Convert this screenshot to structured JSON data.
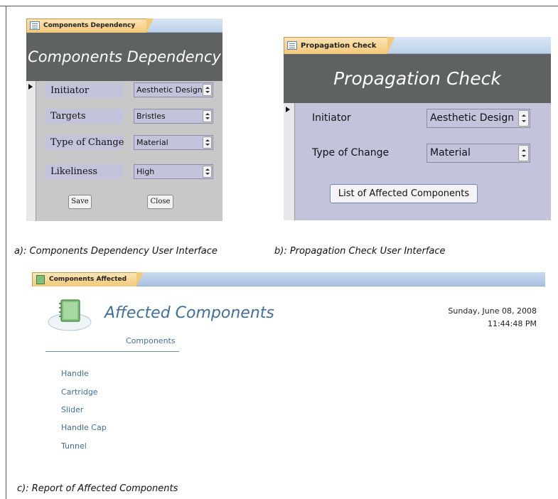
{
  "window_a": {
    "tab_label": "Components Dependency",
    "title": "Components Dependency",
    "fields": [
      {
        "label": "Initiator",
        "value": "Aesthetic Design"
      },
      {
        "label": "Targets",
        "value": "Bristles"
      },
      {
        "label": "Type of Change",
        "value": "Material"
      },
      {
        "label": "Likeliness",
        "value": "High"
      }
    ],
    "save_label": "Save",
    "close_label": "Close"
  },
  "window_b": {
    "tab_label": "Propagation Check",
    "title": "Propagation Check",
    "fields": [
      {
        "label": "Initiator",
        "value": "Aesthetic Design"
      },
      {
        "label": "Type of Change",
        "value": "Material"
      }
    ],
    "button_label": "List of Affected Components"
  },
  "captions": {
    "a": "a): Components Dependency User Interface",
    "b": "b): Propagation Check User Interface",
    "c": "c): Report of Affected Components"
  },
  "window_c": {
    "tab_label": "Components Affected",
    "title": "Affected Components",
    "column_header": "Components",
    "date": "Sunday, June 08, 2008",
    "time": "11:44:48 PM",
    "items": [
      "Handle",
      "Cartridge",
      "Slider",
      "Handle Cap",
      "Tunnel"
    ]
  },
  "colors": {
    "header_gray": "#5f6262",
    "field_lavender": "#c4c3dc",
    "tab_orange": "#f3c879",
    "report_blue": "#3f6f9e"
  },
  "icons": [
    "form-icon",
    "record-selector-arrow-icon",
    "spin-up-icon",
    "spin-down-icon",
    "report-icon",
    "notebook-logo-icon"
  ]
}
